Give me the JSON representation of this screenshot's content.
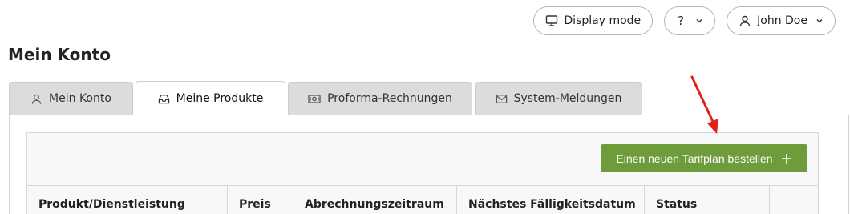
{
  "header": {
    "display_mode_label": "Display mode",
    "help_label": "?",
    "user_name": "John Doe"
  },
  "page": {
    "title": "Mein Konto"
  },
  "tabs": [
    {
      "label": "Mein Konto",
      "icon": "user-icon",
      "active": false
    },
    {
      "label": "Meine Produkte",
      "icon": "inbox-icon",
      "active": true
    },
    {
      "label": "Proforma-Rechnungen",
      "icon": "money-icon",
      "active": false
    },
    {
      "label": "System-Meldungen",
      "icon": "envelope-icon",
      "active": false
    }
  ],
  "products": {
    "order_button_label": "Einen neuen Tarifplan bestellen",
    "columns": [
      "Produkt/Dienstleistung",
      "Preis",
      "Abrechnungszeitraum",
      "Nächstes Fälligkeitsdatum",
      "Status",
      ""
    ]
  },
  "colors": {
    "accent_green": "#6e9c3a",
    "annotation_arrow": "#e0211b",
    "tab_inactive": "#dcdcdc"
  }
}
